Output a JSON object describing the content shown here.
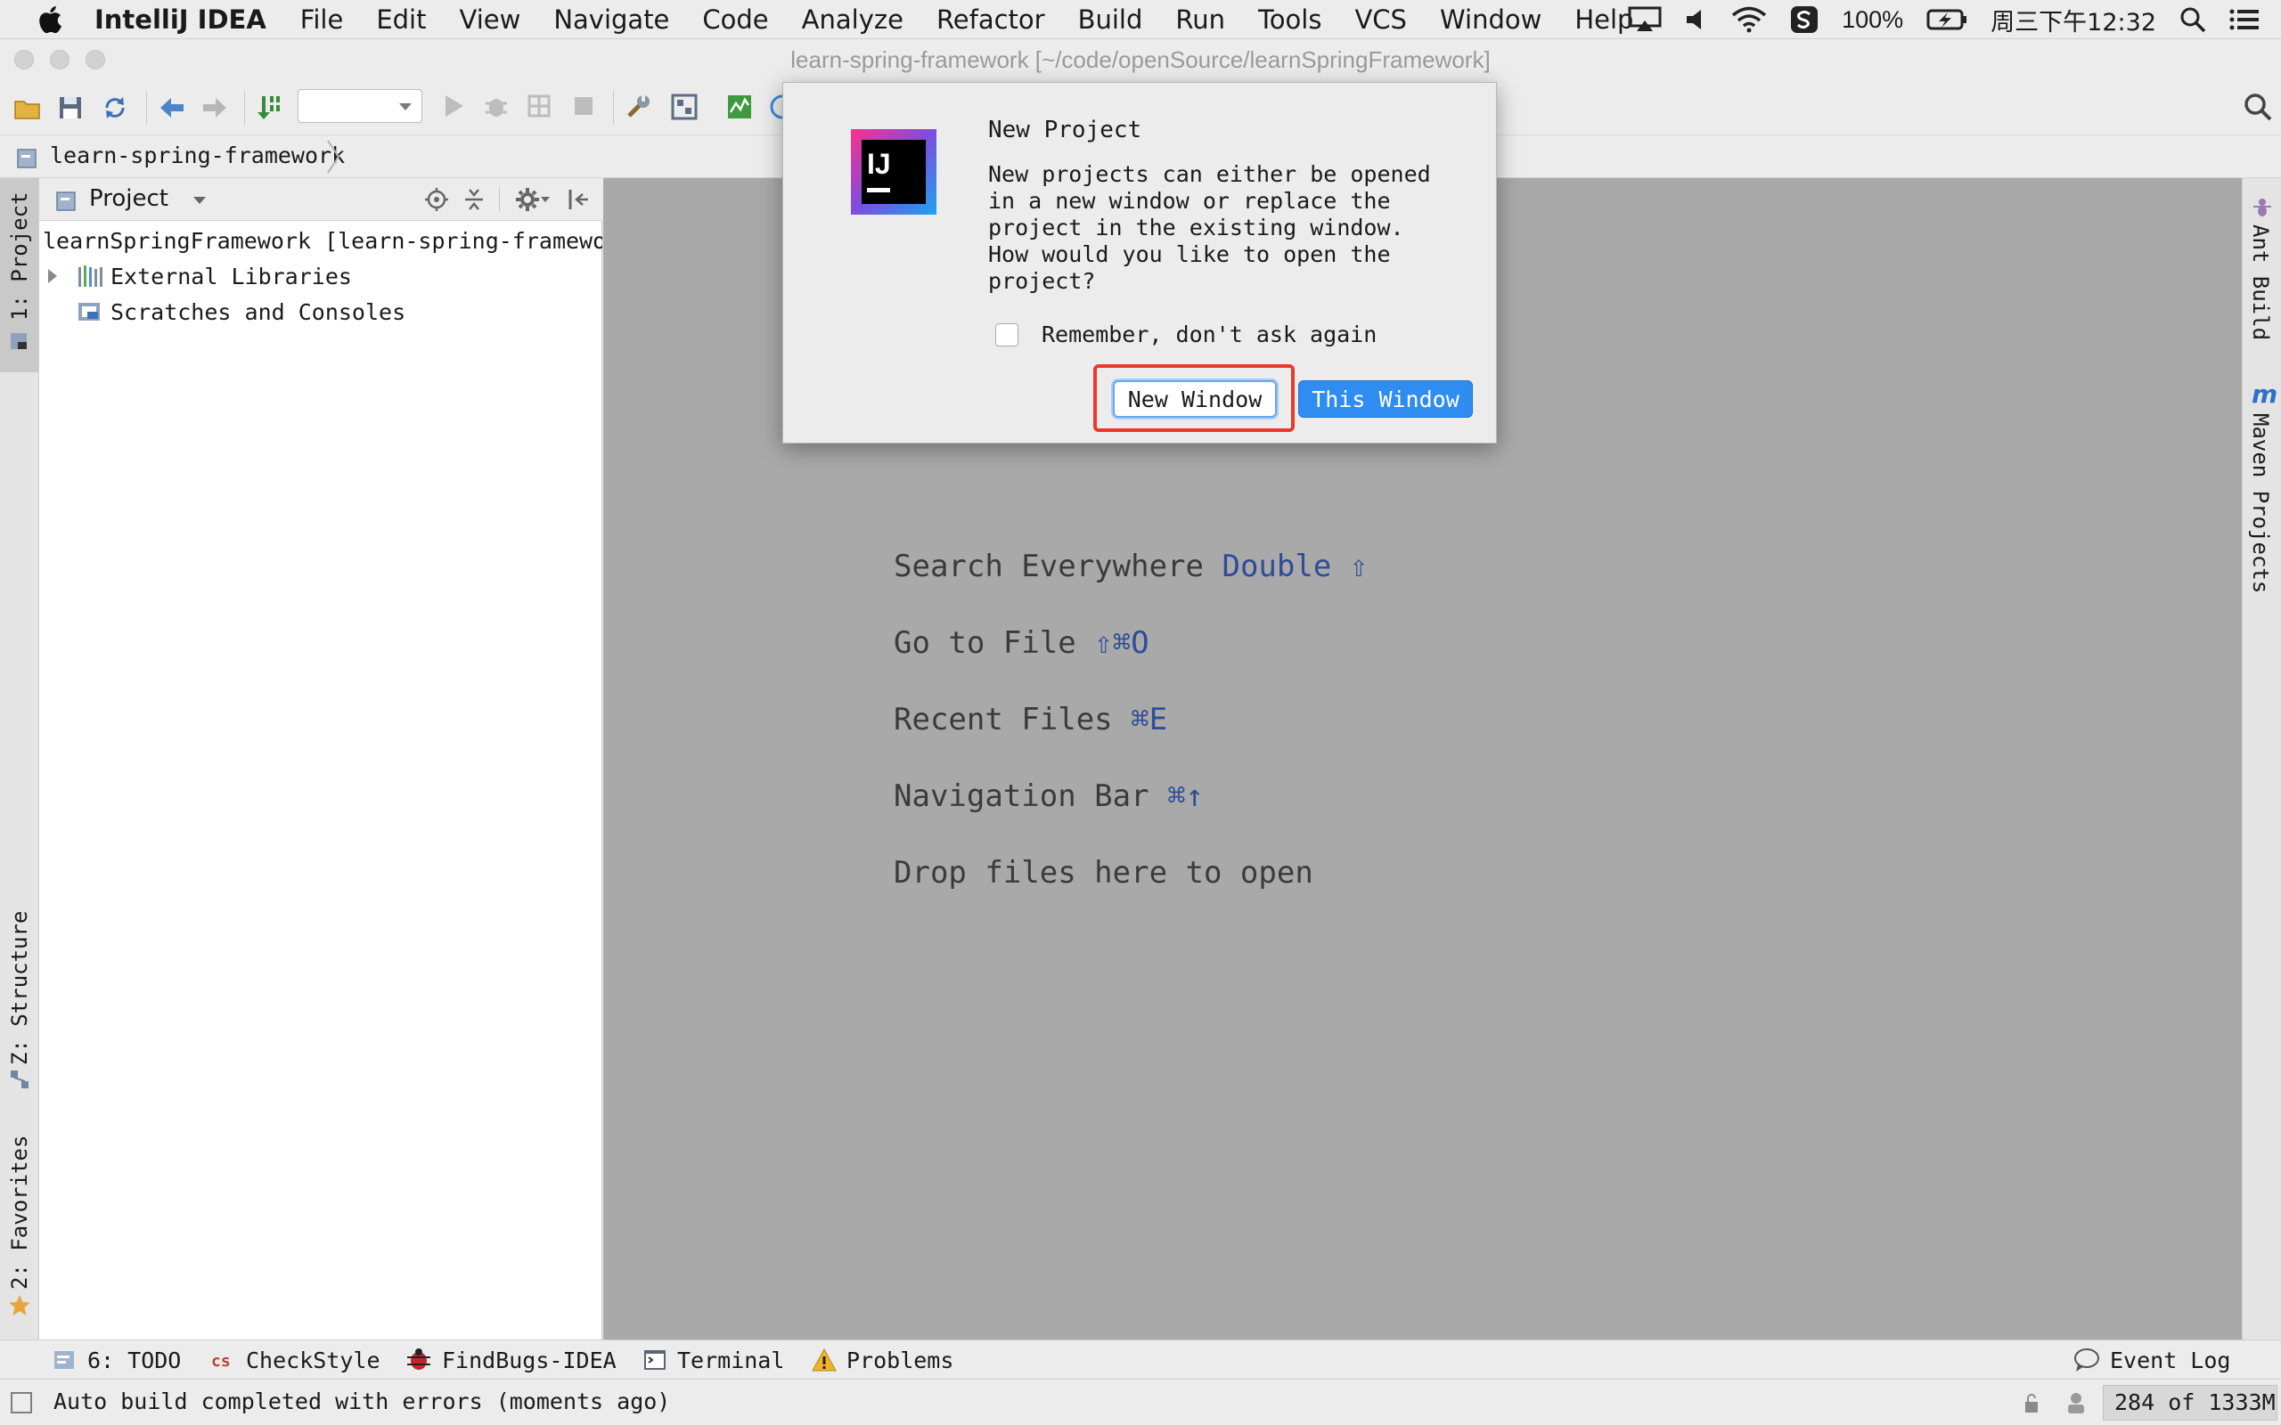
{
  "menubar": {
    "app_name": "IntelliJ IDEA",
    "items": [
      "File",
      "Edit",
      "View",
      "Navigate",
      "Code",
      "Analyze",
      "Refactor",
      "Build",
      "Run",
      "Tools",
      "VCS",
      "Window",
      "Help"
    ],
    "battery": "100%",
    "clock": "周三下午12:32"
  },
  "window": {
    "title": "learn-spring-framework [~/code/openSource/learnSpringFramework]"
  },
  "breadcrumb": {
    "project": "learn-spring-framework"
  },
  "left_stripe": {
    "project_tab": "1: Project",
    "structure_tab": "Z: Structure",
    "favorites_tab": "2: Favorites"
  },
  "right_stripe": {
    "ant_tab": "Ant Build",
    "maven_tab": "Maven Projects"
  },
  "project_panel": {
    "view_label": "Project",
    "tree": [
      {
        "label": "learnSpringFramework [learn-spring-framework]",
        "icon": "module-folder-icon",
        "expandable": true
      },
      {
        "label": "External Libraries",
        "icon": "libraries-icon",
        "expandable": true
      },
      {
        "label": "Scratches and Consoles",
        "icon": "scratches-icon",
        "expandable": false
      }
    ]
  },
  "editor": {
    "hints": [
      {
        "text": "Search Everywhere",
        "key": "Double ⇧"
      },
      {
        "text": "Go to File",
        "key": "⇧⌘O"
      },
      {
        "text": "Recent Files",
        "key": "⌘E"
      },
      {
        "text": "Navigation Bar",
        "key": "⌘↑"
      },
      {
        "text": "Drop files here to open",
        "key": ""
      }
    ]
  },
  "dialog": {
    "title": "New Project",
    "message": "New projects can either be opened\nin a new window or replace the\nproject in the existing window.\nHow would you like to open the\nproject?",
    "checkbox_label": "Remember, don't ask again",
    "checkbox_checked": false,
    "new_window_button": "New Window",
    "this_window_button": "This Window",
    "highlight_color": "#e8392a",
    "primary_color": "#2f8cf0"
  },
  "bottom_tools": {
    "todo": "6: TODO",
    "checkstyle": "CheckStyle",
    "findbugs": "FindBugs-IDEA",
    "terminal": "Terminal",
    "problems": "Problems",
    "event_log": "Event Log"
  },
  "status": {
    "message": "Auto build completed with errors (moments ago)",
    "memory": "284 of 1333M"
  }
}
